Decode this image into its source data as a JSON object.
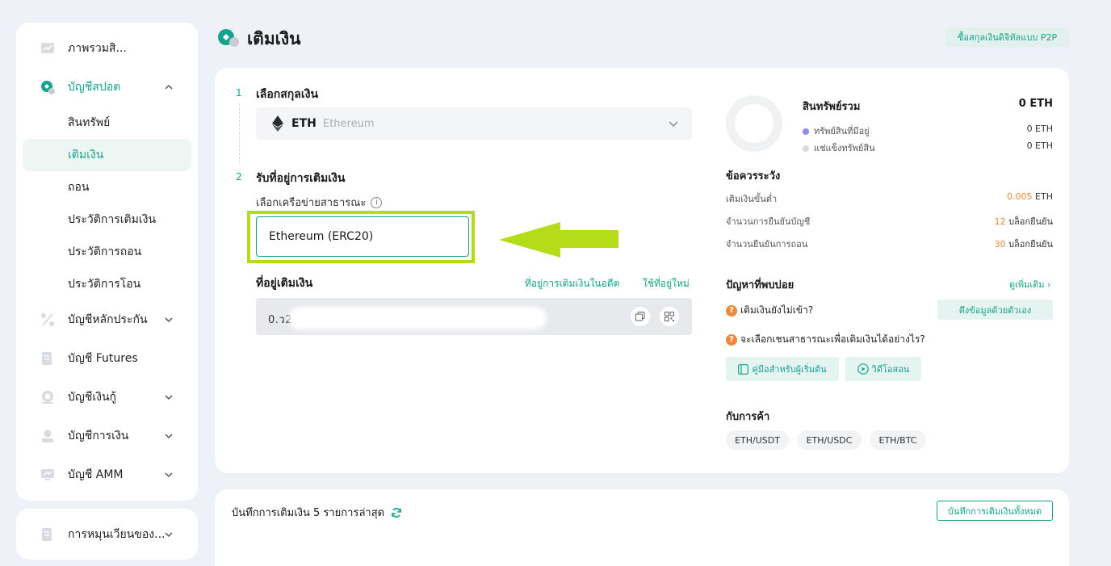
{
  "sidebar": {
    "items": [
      {
        "label": "ภาพรวมสิ..."
      },
      {
        "label": "บัญชีสปอต"
      },
      {
        "label": "สินทรัพย์"
      },
      {
        "label": "เติมเงิน"
      },
      {
        "label": "ถอน"
      },
      {
        "label": "ประวัติการเติมเงิน"
      },
      {
        "label": "ประวัติการถอน"
      },
      {
        "label": "ประวัติการโอน"
      },
      {
        "label": "บัญชีหลักประกัน"
      },
      {
        "label": "บัญชี Futures"
      },
      {
        "label": "บัญชีเงินกู้"
      },
      {
        "label": "บัญชีการเงิน"
      },
      {
        "label": "บัญชี AMM"
      }
    ],
    "bottom_item": {
      "label": "การหมุนเวียนของ..."
    }
  },
  "header": {
    "title": "เติมเงิน",
    "p2p_button": "ซื้อสกุลเงินดิจิทัลแบบ P2P"
  },
  "steps": {
    "step1_num": "1",
    "step1_title": "เลือกสกุลเงิน",
    "step2_num": "2",
    "step2_title": "รับที่อยู่การเติมเงิน"
  },
  "coin": {
    "symbol": "ETH",
    "name": "Ethereum"
  },
  "network": {
    "label": "เลือกเครือข่ายสาธารณะ",
    "value": "Ethereum (ERC20)"
  },
  "address": {
    "title": "ที่อยู่เติมเงิน",
    "history_link": "ที่อยู่การเติมเงินในอดีต",
    "new_link": "ใช้ที่อยู่ใหม่",
    "value": "0.ว2ย07โ0ว0ว                         0ว0  7ว7 ว"
  },
  "assets": {
    "title": "สินทรัพย์รวม",
    "total": "0 ETH",
    "available_label": "ทรัพย์สินที่มีอยู่",
    "available_value": "0 ETH",
    "frozen_label": "แช่แข็งทรัพย์สิน",
    "frozen_value": "0 ETH",
    "available_color": "#8b8df0",
    "frozen_color": "#d8dae0"
  },
  "notes": {
    "title": "ข้อควรระวัง",
    "min_label": "เติมเงินขั้นต่ำ",
    "min_num": "0.005",
    "min_unit": "ETH",
    "confirm_label": "จำนวนการยืนยันบัญชี",
    "confirm_num": "12",
    "confirm_unit": "บล็อกยืนยัน",
    "withdraw_label": "จำนวนยืนยันการถอน",
    "withdraw_num": "30",
    "withdraw_unit": "บล็อกยืนยัน"
  },
  "faq": {
    "title": "ปัญหาที่พบบ่อย",
    "more": "ดูเพิ่มเติม ›",
    "q1": "เติมเงินยังไม่เข้า?",
    "fetch_button": "ดึงข้อมูลด้วยตัวเอง",
    "q2": "จะเลือกเชนสาธารณะเพื่อเติมเงินได้อย่างไร?",
    "guide_button": "คู่มือสำหรับผู้เริ่มต้น",
    "video_button": "วิดีโอสอน"
  },
  "trade": {
    "title": "กับการค้า",
    "pairs": [
      "ETH/USDT",
      "ETH/USDC",
      "ETH/BTC"
    ]
  },
  "history": {
    "title": "บันทึกการเติมเงิน 5 รายการล่าสุด",
    "all_button": "บันทึกการเติมเงินทั้งหมด"
  },
  "colors": {
    "accent": "#14a38b",
    "highlight": "#b4dc19",
    "orange": "#f0883a"
  }
}
